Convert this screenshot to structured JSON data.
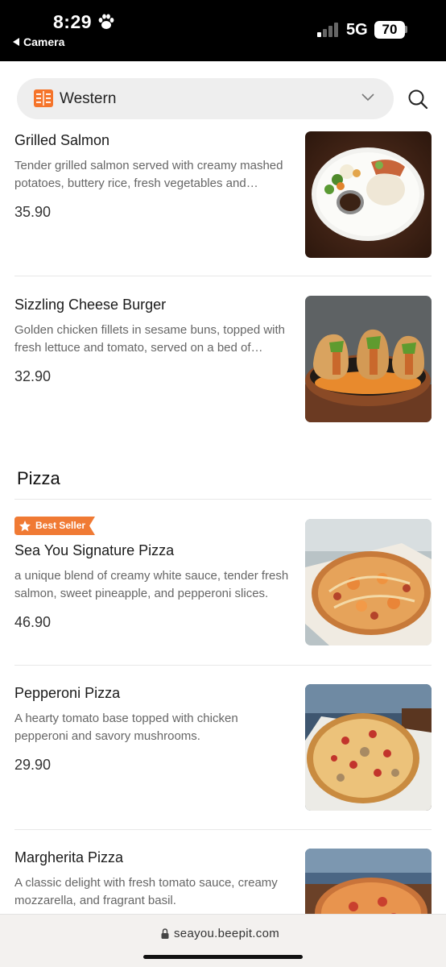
{
  "status_bar": {
    "time": "8:29",
    "back_label": "Camera",
    "network": "5G",
    "battery": "70"
  },
  "filter": {
    "selected": "Western"
  },
  "items_top": [
    {
      "name": "Grilled Salmon",
      "description": "Tender grilled salmon served with creamy mashed potatoes, buttery rice, fresh vegetables and mushroom sauce.",
      "price": "35.90"
    },
    {
      "name": "Sizzling Cheese Burger",
      "description": "Golden chicken fillets in sesame buns, topped with fresh lettuce and tomato, served on a bed of sizzling cheese sauce.",
      "price": "32.90"
    }
  ],
  "section": {
    "title": "Pizza"
  },
  "items_pizza": [
    {
      "badge": "Best Seller",
      "name": "Sea You Signature Pizza",
      "description": "a unique blend of creamy white sauce, tender fresh salmon, sweet pineapple, and pepperoni slices.",
      "price": "46.90"
    },
    {
      "name": "Pepperoni Pizza",
      "description": "A hearty tomato base topped with chicken pepperoni and savory mushrooms.",
      "price": "29.90"
    },
    {
      "name": "Margherita Pizza",
      "description": "A classic delight with fresh tomato sauce, creamy mozzarella, and fragrant basil.",
      "price": ""
    }
  ],
  "browser": {
    "url": "seayou.beepit.com"
  },
  "colors": {
    "accent": "#f5742a",
    "badge": "#f07a34"
  },
  "icons": [
    "paw-icon",
    "signal-icon",
    "book-icon",
    "chevron-down-icon",
    "search-icon",
    "star-icon",
    "lock-icon"
  ]
}
